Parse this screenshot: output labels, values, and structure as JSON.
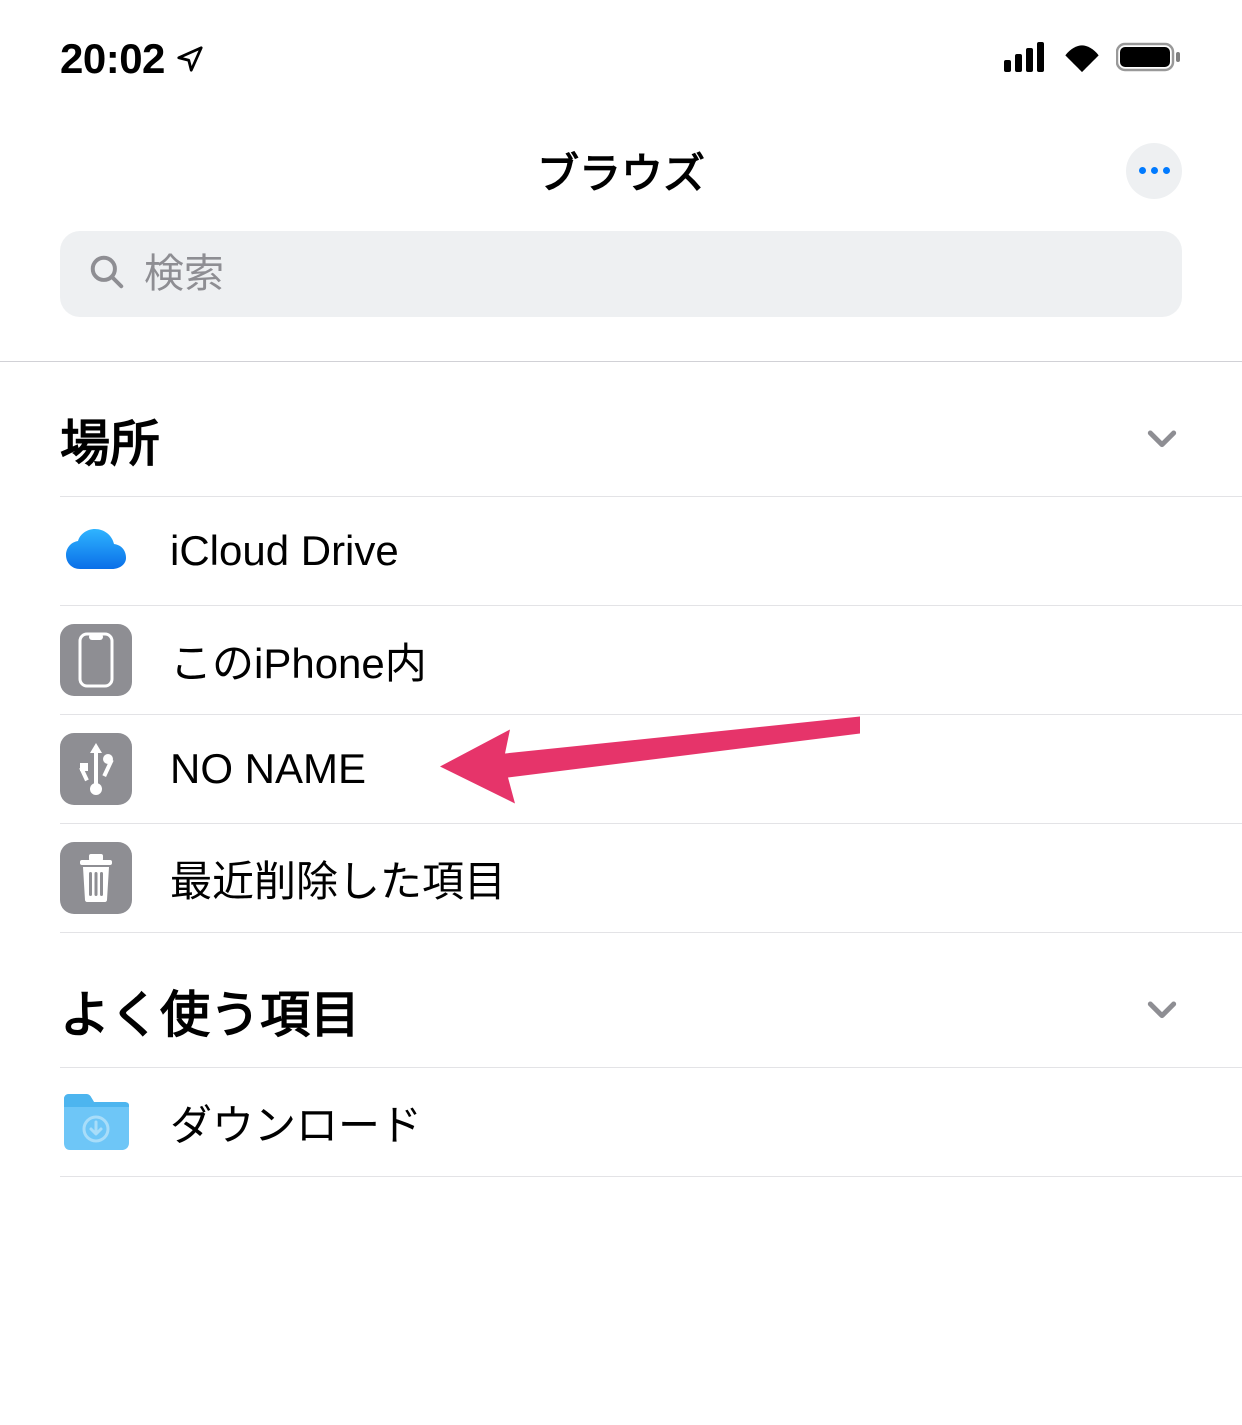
{
  "status_bar": {
    "time": "20:02"
  },
  "nav": {
    "title": "ブラウズ"
  },
  "search": {
    "placeholder": "検索"
  },
  "sections": {
    "locations": {
      "title": "場所",
      "items": [
        {
          "label": "iCloud Drive",
          "icon": "icloud"
        },
        {
          "label": "このiPhone内",
          "icon": "iphone"
        },
        {
          "label": "NO NAME",
          "icon": "usb"
        },
        {
          "label": "最近削除した項目",
          "icon": "trash"
        }
      ]
    },
    "favorites": {
      "title": "よく使う項目",
      "items": [
        {
          "label": "ダウンロード",
          "icon": "downloads-folder"
        }
      ]
    }
  },
  "colors": {
    "accent": "#007aff",
    "annotation": "#e6346a",
    "icon_gray": "#8e8e93",
    "folder_blue": "#6ec6f7"
  }
}
